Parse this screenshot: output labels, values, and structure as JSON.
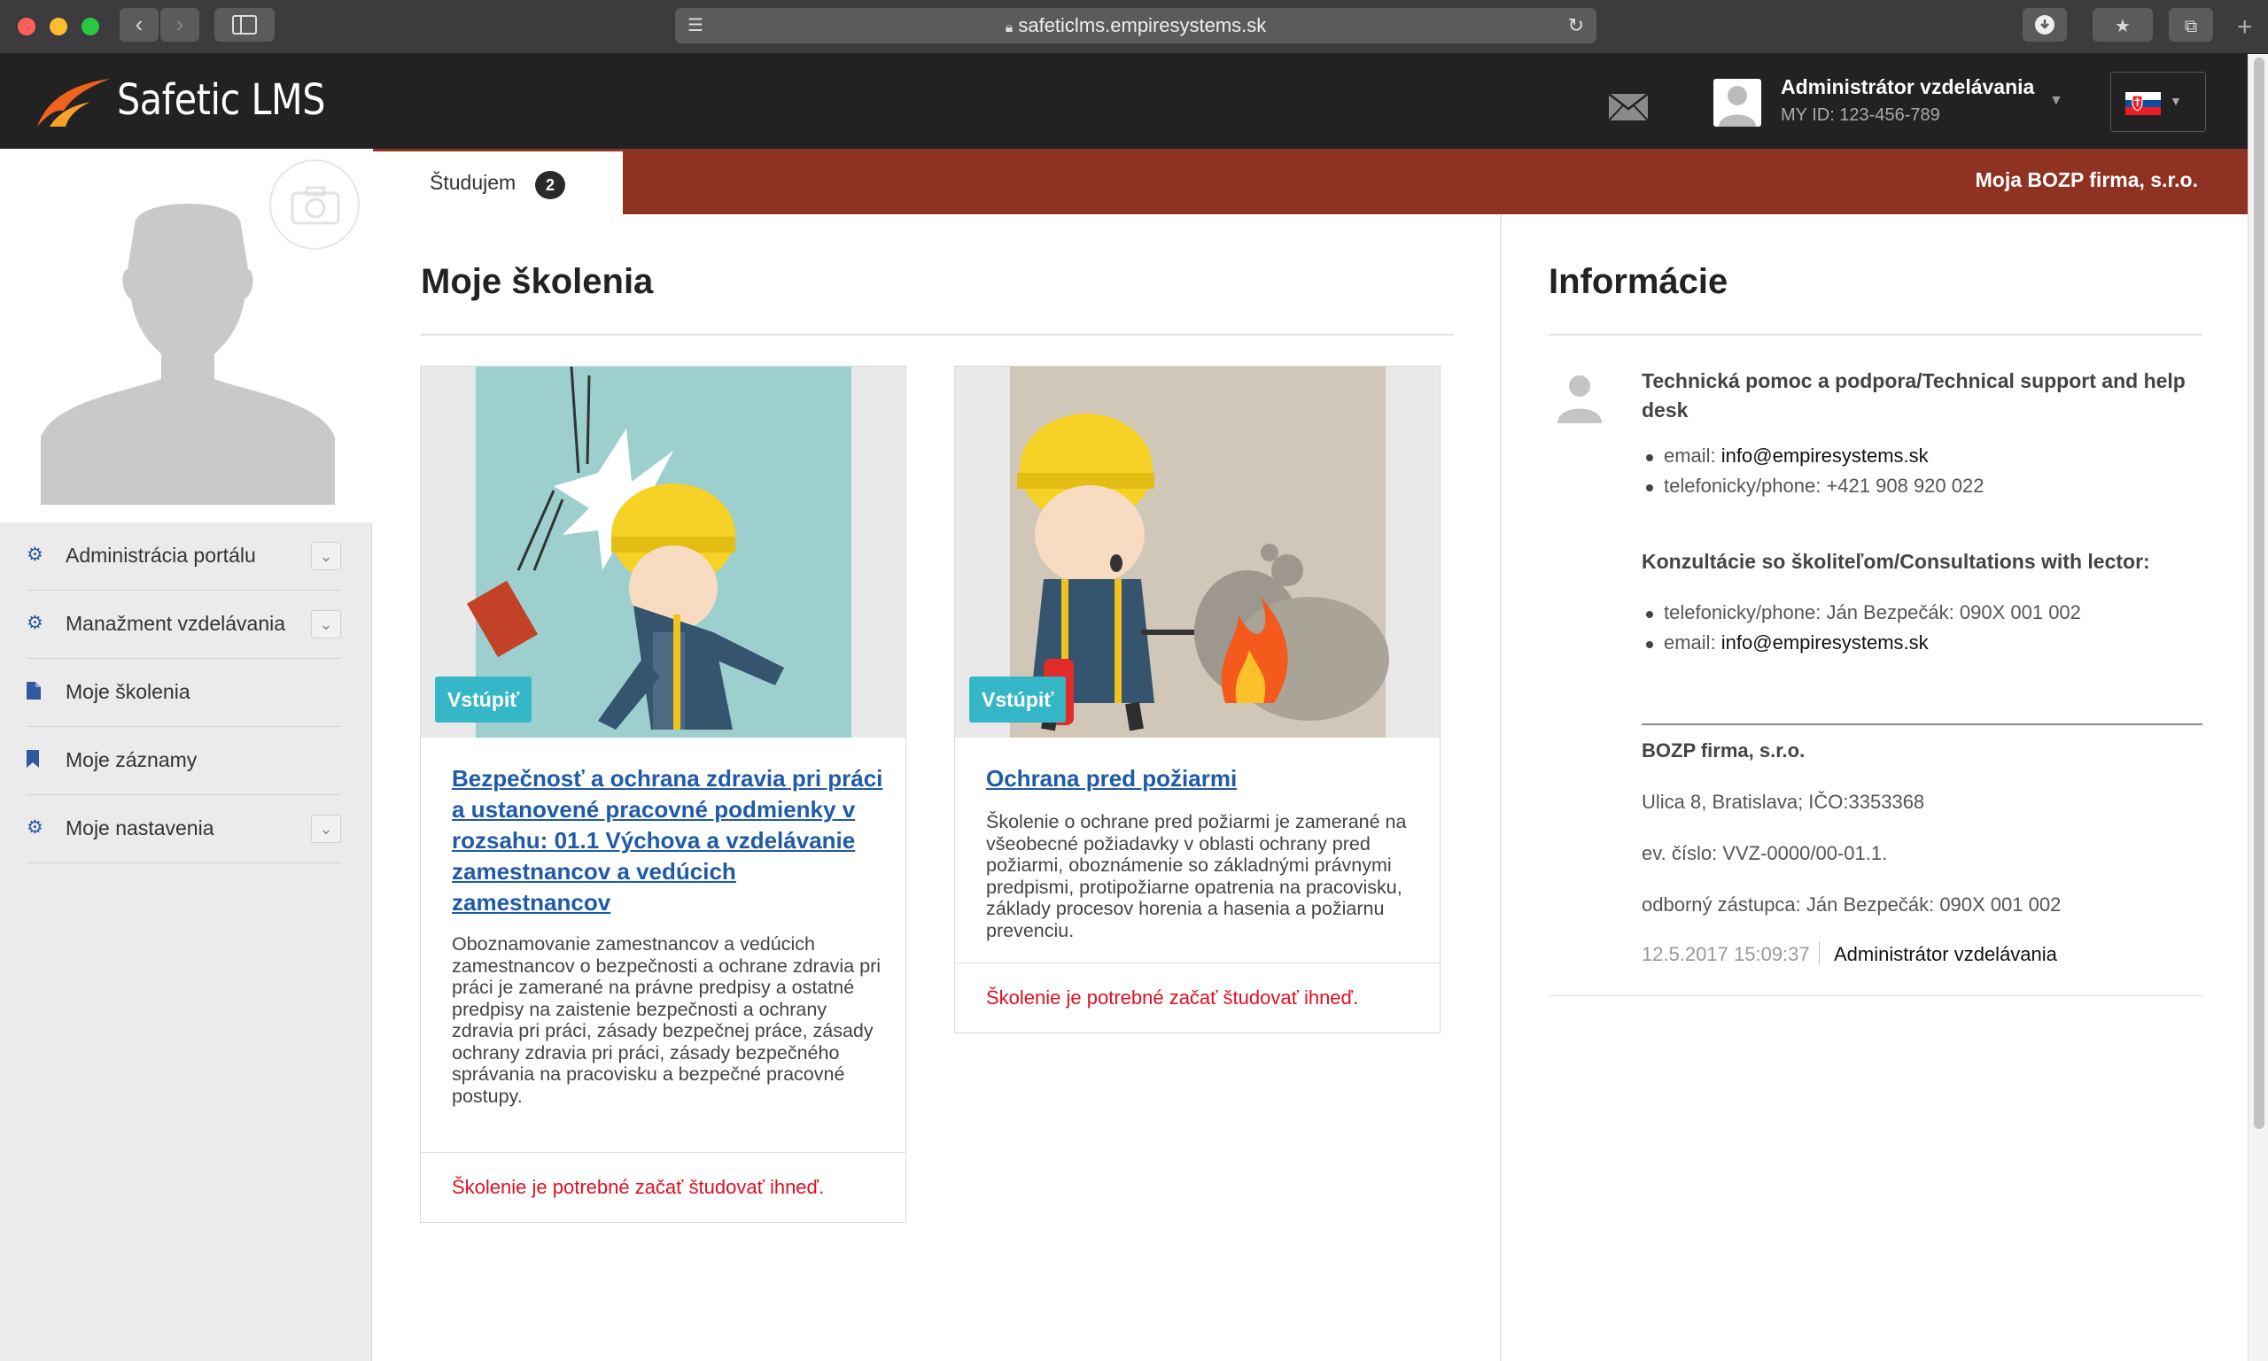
{
  "browser": {
    "url": "safeticlms.empiresystems.sk"
  },
  "header": {
    "logo_text": "Safetic LMS",
    "user_name": "Administrátor vzdelávania",
    "user_id": "MY ID: 123-456-789"
  },
  "tabs": {
    "active_label": "Študujem",
    "active_badge": "2",
    "firm_name": "Moja BOZP firma, s.r.o."
  },
  "sidebar": {
    "items": [
      {
        "label": "Administrácia portálu",
        "icon": "gear-icon",
        "expandable": true
      },
      {
        "label": "Manažment vzdelávania",
        "icon": "gear-icon",
        "expandable": true
      },
      {
        "label": "Moje školenia",
        "icon": "document-icon",
        "expandable": false
      },
      {
        "label": "Moje záznamy",
        "icon": "bookmark-icon",
        "expandable": false
      },
      {
        "label": "Moje nastavenia",
        "icon": "gear-icon",
        "expandable": true
      }
    ]
  },
  "main": {
    "title": "Moje školenia",
    "courses": [
      {
        "enter_label": "Vstúpiť",
        "title": "Bezpečnosť a ochrana zdravia pri práci a ustanovené pracovné podmienky v rozsahu: 01.1 Výchova a vzdelávanie zamestnancov a vedúcich zamestnancov",
        "description": "Oboznamovanie zamestnancov a vedúcich zamestnancov o bezpečnosti a ochrane zdravia pri práci je zamerané na právne predpisy a ostatné predpisy na zaistenie bezpečnosti a ochrany zdravia pri práci, zásady bezpečnej práce, zásady ochrany zdravia pri práci, zásady bezpečného správania na pracovisku a bezpečné pracovné postupy.",
        "warning": "Školenie je potrebné začať študovať ihneď."
      },
      {
        "enter_label": "Vstúpiť",
        "title": "Ochrana pred požiarmi",
        "description": "Školenie o ochrane pred požiarmi je zamerané na všeobecné požiadavky v oblasti ochrany pred požiarmi, oboznámenie so základnými právnymi predpismi, protipožiarne opatrenia na pracovisku, základy procesov horenia a hasenia a požiarnu prevenciu.",
        "warning": "Školenie je potrebné začať študovať ihneď."
      }
    ]
  },
  "info": {
    "title": "Informácie",
    "support_title": "Technická pomoc a podpora/Technical support and help desk",
    "support_email_label": "email: ",
    "support_email": "info@empiresystems.sk",
    "support_phone": "telefonicky/phone: +421 908 920 022",
    "consult_title": "Konzultácie so školiteľom/Consultations with lector:",
    "consult_phone": "telefonicky/phone: Ján Bezpečák: 090X 001 002",
    "consult_email_label": "email: ",
    "consult_email": "info@empiresystems.sk",
    "company": "BOZP firma, s.r.o.",
    "address": "Ulica 8, Bratislava; IČO:3353368",
    "ev_number": "ev. číslo: VVZ-0000/00-01.1.",
    "representative": "odborný zástupca: Ján Bezpečák: 090X 001 002",
    "timestamp": "12.5.2017 15:09:37",
    "author": "Administrátor vzdelávania"
  },
  "colors": {
    "accent_red": "#8f3221",
    "header_dark": "#222223",
    "link_blue": "#1f5aa9",
    "enter_cyan": "#36b7c8",
    "warning_red": "#e0101f"
  }
}
